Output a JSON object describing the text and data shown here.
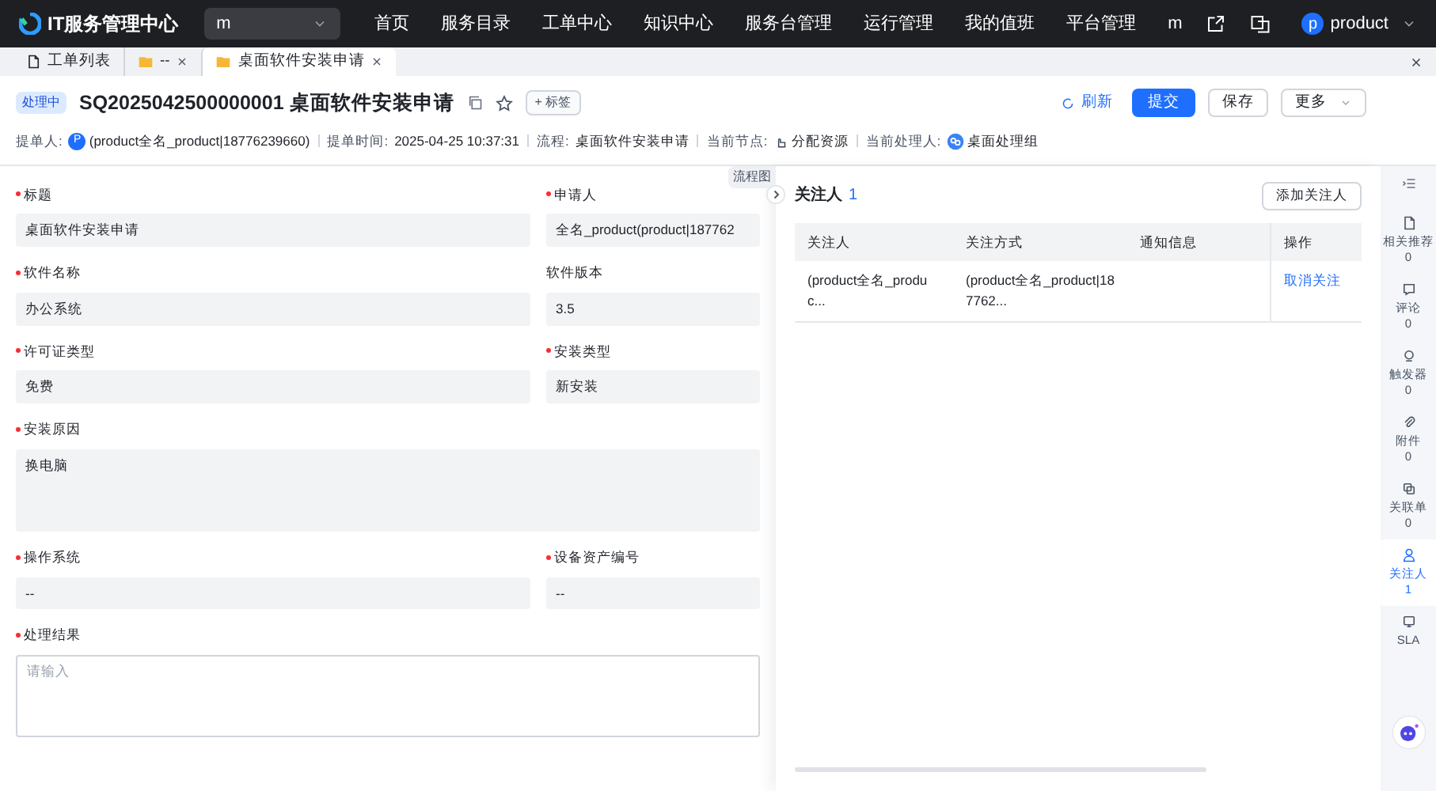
{
  "topbar": {
    "app_name": "IT服务管理中心",
    "workspace_select": "m",
    "menu": [
      "首页",
      "服务目录",
      "工单中心",
      "知识中心",
      "服务台管理",
      "运行管理",
      "我的值班",
      "平台管理",
      "m"
    ],
    "user": {
      "avatar": "p",
      "name": "product"
    }
  },
  "tabs": [
    {
      "label": "工单列表",
      "closable": false,
      "selected": false
    },
    {
      "label": "--",
      "closable": true,
      "selected": false
    },
    {
      "label": "桌面软件安装申请",
      "closable": true,
      "selected": true
    }
  ],
  "header": {
    "status": "处理中",
    "title": "SQ2025042500000001 桌面软件安装申请",
    "tag_button": "+ 标签",
    "refresh": "刷新",
    "submit": "提交",
    "save": "保存",
    "more": "更多"
  },
  "meta": [
    {
      "label": "提单人:",
      "value": "(product全名_product|18776239660)",
      "kind": "person",
      "avatar": "P"
    },
    {
      "label": "提单时间:",
      "value": "2025-04-25 10:37:31",
      "kind": "text"
    },
    {
      "label": "流程:",
      "value": "桌面软件安装申请",
      "kind": "text"
    },
    {
      "label": "当前节点:",
      "value": "分配资源",
      "kind": "node"
    },
    {
      "label": "当前处理人:",
      "value": "桌面处理组",
      "kind": "group"
    }
  ],
  "form": {
    "rows": [
      [
        {
          "label": "标题",
          "required": true,
          "value": "桌面软件安装申请",
          "kind": "input"
        },
        {
          "label": "申请人",
          "required": true,
          "value": "全名_product(product|187762",
          "kind": "input"
        }
      ],
      [
        {
          "label": "软件名称",
          "required": true,
          "value": "办公系统",
          "kind": "input"
        },
        {
          "label": "软件版本",
          "required": false,
          "value": "3.5",
          "kind": "input"
        }
      ],
      [
        {
          "label": "许可证类型",
          "required": true,
          "value": "免费",
          "kind": "input"
        },
        {
          "label": "安装类型",
          "required": true,
          "value": "新安装",
          "kind": "input"
        }
      ],
      [
        {
          "label": "安装原因",
          "required": true,
          "value": "换电脑",
          "kind": "textarea"
        }
      ],
      [
        {
          "label": "操作系统",
          "required": true,
          "value": "--",
          "kind": "input"
        },
        {
          "label": "设备资产编号",
          "required": true,
          "value": "--",
          "kind": "input"
        }
      ],
      [
        {
          "label": "处理结果",
          "required": true,
          "placeholder": "请输入",
          "kind": "editor"
        }
      ]
    ]
  },
  "flow_tab": "流程图",
  "drawer": {
    "title": "关注人",
    "count": "1",
    "add_button": "添加关注人",
    "columns": [
      "关注人",
      "关注方式",
      "通知信息",
      "操作"
    ],
    "rows": [
      {
        "cells": [
          "(product全名_produc...",
          "(product全名_product|187762...",
          ""
        ],
        "action": "取消关注"
      }
    ]
  },
  "side_panel": [
    {
      "label": "相关推荐",
      "count": "0",
      "selected": false
    },
    {
      "label": "评论",
      "count": "0",
      "selected": false
    },
    {
      "label": "触发器",
      "count": "0",
      "selected": false
    },
    {
      "label": "附件",
      "count": "0",
      "selected": false
    },
    {
      "label": "关联单",
      "count": "0",
      "selected": false
    },
    {
      "label": "关注人",
      "count": "1",
      "selected": true
    },
    {
      "label": "SLA",
      "selected": false
    }
  ]
}
